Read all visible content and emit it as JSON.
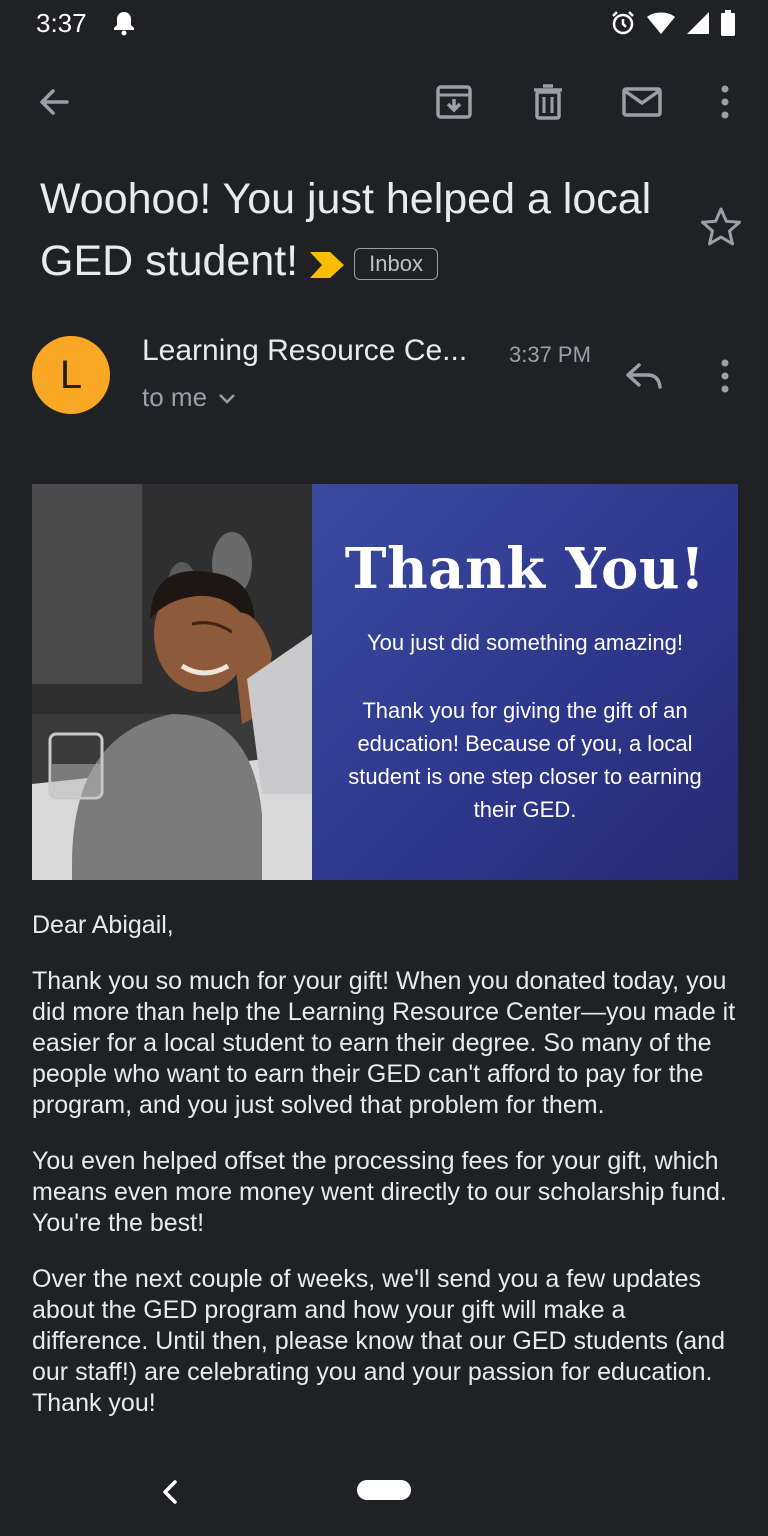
{
  "status_bar": {
    "time": "3:37",
    "icons": [
      "bell-icon",
      "alarm-icon",
      "wifi-icon",
      "signal-icon",
      "battery-icon"
    ]
  },
  "toolbar": {
    "icons": [
      "back-arrow-icon",
      "archive-icon",
      "delete-icon",
      "mark-unread-icon",
      "more-vert-icon"
    ]
  },
  "email": {
    "subject": "Woohoo! You just helped a local GED student!",
    "label": "Inbox",
    "importance_color": "#fbbc04",
    "sender": {
      "initial": "L",
      "avatar_color": "#f9a825",
      "name": "Learning Resource Ce...",
      "time": "3:37 PM",
      "recipient": "to me"
    }
  },
  "banner": {
    "title": "Thank You!",
    "subtitle": "You just did something amazing!",
    "body": "Thank you for giving the gift of an education! Because of you, a local student is one step closer to earning their GED.",
    "panel_color": "#2e388c"
  },
  "body": {
    "greeting": "Dear Abigail,",
    "paragraphs": [
      "Thank you so much for your gift! When you donated today, you did more than help the Learning Resource Center—you made it easier for a local student to earn their degree. So many of the people who want to earn their GED can't afford to pay for the program, and you just solved that problem for them.",
      "You even helped offset the processing fees for your gift, which means even more money went directly to our scholarship fund. You're the best!",
      "Over the next couple of weeks, we'll send you a few updates about the GED program and how your gift will make a difference. Until then, please know that our GED students (and our staff!) are celebrating you and your passion for education. Thank you!"
    ]
  }
}
